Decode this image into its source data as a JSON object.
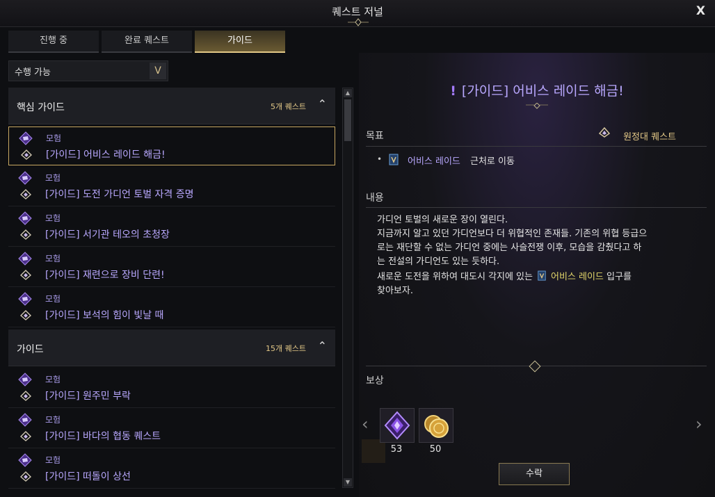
{
  "window": {
    "title": "퀘스트 저널",
    "close_label": "X"
  },
  "tabs": [
    {
      "label": "진행 중"
    },
    {
      "label": "완료 퀘스트"
    },
    {
      "label": "가이드"
    }
  ],
  "filter": {
    "value": "수행 가능",
    "arrow": "V"
  },
  "categories": [
    {
      "name": "핵심 가이드",
      "count": "5개 퀘스트",
      "items": [
        {
          "type": "모험",
          "name": "[가이드] 어비스 레이드 해금!"
        },
        {
          "type": "모험",
          "name": "[가이드] 도전 가디언 토벌 자격 증명"
        },
        {
          "type": "모험",
          "name": "[가이드] 서기관 테오의 초청장"
        },
        {
          "type": "모험",
          "name": "[가이드] 재련으로 장비 단련!"
        },
        {
          "type": "모험",
          "name": "[가이드] 보석의 힘이 빛날 때"
        }
      ]
    },
    {
      "name": "가이드",
      "count": "15개 퀘스트",
      "items": [
        {
          "type": "모험",
          "name": "[가이드] 원주민 부락"
        },
        {
          "type": "모험",
          "name": "[가이드] 바다의 협동 퀘스트"
        },
        {
          "type": "모험",
          "name": "[가이드] 떠돌이 상선"
        }
      ]
    }
  ],
  "detail": {
    "title": "[가이드] 어비스 레이드 해금!",
    "goal_label": "목표",
    "quest_type": "원정대 퀘스트",
    "goal": {
      "link": "어비스 레이드",
      "rest": "근처로 이동"
    },
    "content_label": "내용",
    "desc_lines": [
      "가디언 토벌의 새로운 장이 열린다.",
      "지금까지 알고 있던 가디언보다 더 위협적인 존재들. 기존의 위협 등급으",
      "로는 재단할 수 없는 가디언 중에는 사슬전쟁 이후, 모습을 감췄다고 하",
      "는 전설의 가디언도 있는 듯하다."
    ],
    "desc_last": {
      "before": "새로운 도전을 위하여 대도시 각지에 있는",
      "link": "어비스 레이드",
      "after": "입구를",
      "line2": "찾아보자."
    },
    "reward_label": "보상",
    "rewards": [
      {
        "icon": "purple-crystal-icon",
        "count": "53"
      },
      {
        "icon": "gold-coin-icon",
        "count": "50"
      }
    ],
    "accept_label": "수락"
  },
  "colors": {
    "accent_gold": "#e3c887",
    "quest_purple": "#b9a8ff",
    "highlight_yellow": "#e3d66a"
  }
}
